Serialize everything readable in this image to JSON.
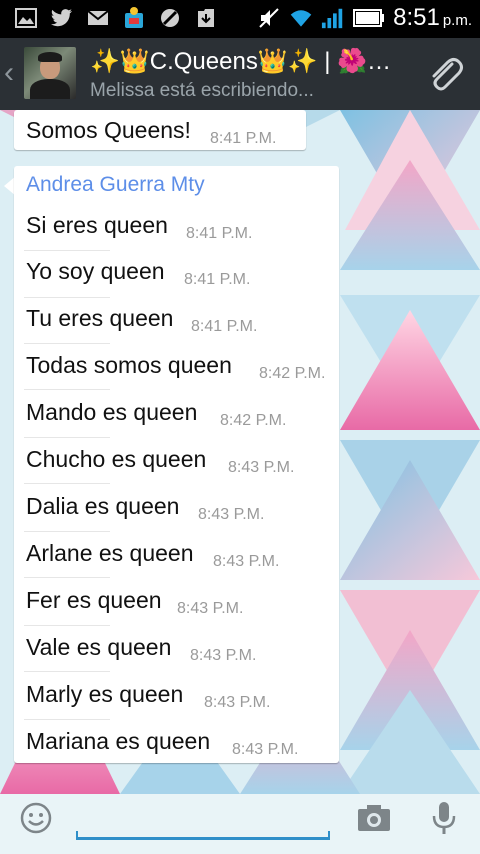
{
  "status_bar": {
    "time": "8:51",
    "ampm": "p.m."
  },
  "header": {
    "title": "✨👑C.Queens👑✨ | 🌺…",
    "subtitle": "Melissa está escribiendo..."
  },
  "messages": [
    {
      "text": "Somos Queens!",
      "time": "8:41 P.M."
    }
  ],
  "group_block": {
    "sender": "Andrea Guerra Mty",
    "items": [
      {
        "text": "Si eres queen",
        "time": "8:41 P.M."
      },
      {
        "text": "Yo soy queen",
        "time": "8:41 P.M."
      },
      {
        "text": "Tu eres queen",
        "time": "8:41 P.M."
      },
      {
        "text": "Todas somos queen",
        "time": "8:42 P.M."
      },
      {
        "text": "Mando es queen",
        "time": "8:42 P.M."
      },
      {
        "text": "Chucho es queen",
        "time": "8:43 P.M."
      },
      {
        "text": "Dalia es queen",
        "time": "8:43 P.M."
      },
      {
        "text": "Arlane es queen",
        "time": "8:43 P.M."
      },
      {
        "text": "Fer es queen",
        "time": "8:43 P.M."
      },
      {
        "text": "Vale es queen",
        "time": "8:43 P.M."
      },
      {
        "text": "Marly es queen",
        "time": "8:43 P.M."
      },
      {
        "text": "Mariana es queen",
        "time": "8:43 P.M."
      }
    ]
  },
  "colors": {
    "header_bg": "#2b3035",
    "sender_name": "#5d8ee8",
    "input_accent": "#2f8fc9"
  },
  "icons": {
    "status": [
      "gallery-icon",
      "twitter-icon",
      "mail-icon",
      "app-icon",
      "blocked-icon",
      "download-icon",
      "mute-icon",
      "wifi-icon",
      "signal-icon",
      "battery-icon"
    ],
    "header": [
      "back-icon",
      "avatar",
      "attach-icon"
    ],
    "input": [
      "emoji-icon",
      "camera-icon",
      "mic-icon"
    ]
  }
}
